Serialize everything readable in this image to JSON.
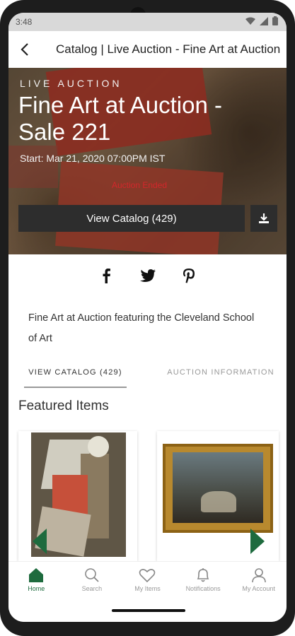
{
  "status_bar": {
    "time": "3:48"
  },
  "app_bar": {
    "title": "Catalog | Live Auction - Fine Art at Auction - Sale 221"
  },
  "hero": {
    "kicker": "LIVE AUCTION",
    "heading": "Fine Art at Auction - Sale 221",
    "start": "Start: Mar 21, 2020 07:00PM IST",
    "status": "Auction Ended",
    "view_catalog_label": "View Catalog (429)"
  },
  "description": "Fine Art at Auction featuring the Cleveland School of Art",
  "tabs": [
    {
      "label": "VIEW CATALOG (429)"
    },
    {
      "label": "AUCTION INFORMATION"
    }
  ],
  "featured": {
    "title": "Featured Items"
  },
  "bottom_nav": [
    {
      "label": "Home",
      "icon": "home-icon",
      "active": true
    },
    {
      "label": "Search",
      "icon": "search-icon",
      "active": false
    },
    {
      "label": "My Items",
      "icon": "heart-icon",
      "active": false
    },
    {
      "label": "Notifications",
      "icon": "bell-icon",
      "active": false
    },
    {
      "label": "My Account",
      "icon": "user-icon",
      "active": false
    }
  ],
  "colors": {
    "accent": "#1e6b3e",
    "status_red": "#d3272b",
    "dark_button": "#2d2d2d"
  }
}
